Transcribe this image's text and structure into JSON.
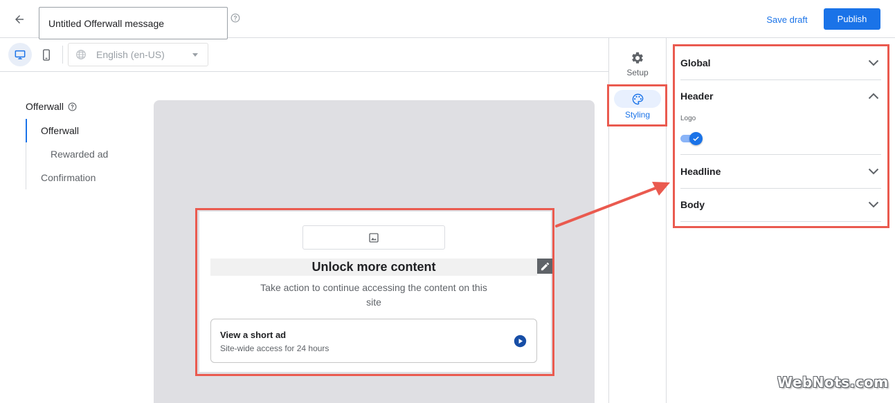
{
  "header": {
    "title_value": "Untitled Offerwall message",
    "save_draft_label": "Save draft",
    "publish_label": "Publish"
  },
  "toolbar": {
    "language": "English (en-US)"
  },
  "nav": {
    "title": "Offerwall",
    "items": [
      {
        "label": "Offerwall"
      },
      {
        "label": "Rewarded ad"
      },
      {
        "label": "Confirmation"
      }
    ]
  },
  "preview": {
    "headline": "Unlock more content",
    "body": "Take action to continue accessing the content on this site",
    "option_title": "View a short ad",
    "option_subtitle": "Site-wide access for 24 hours"
  },
  "rail": {
    "setup_label": "Setup",
    "styling_label": "Styling"
  },
  "panel": {
    "sections": [
      {
        "label": "Global"
      },
      {
        "label": "Header"
      },
      {
        "label": "Headline"
      },
      {
        "label": "Body"
      }
    ],
    "logo_label": "Logo",
    "logo_enabled": true
  },
  "watermark": "WebNots.com",
  "colors": {
    "accent": "#1a73e8",
    "annotation_red": "#ea5a4f",
    "canvas_gray": "#dfdfe3"
  }
}
